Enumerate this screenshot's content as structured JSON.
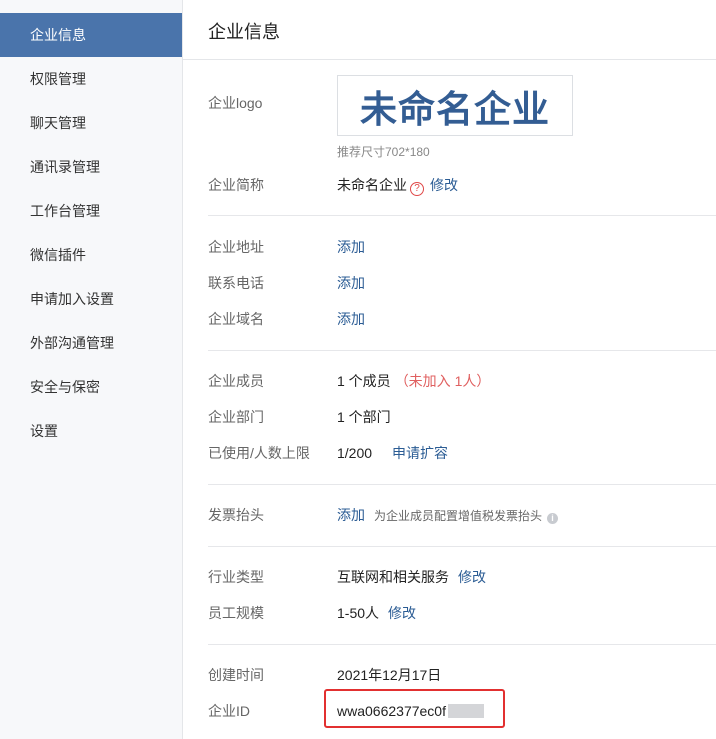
{
  "sidebar": {
    "items": [
      {
        "label": "企业信息"
      },
      {
        "label": "权限管理"
      },
      {
        "label": "聊天管理"
      },
      {
        "label": "通讯录管理"
      },
      {
        "label": "工作台管理"
      },
      {
        "label": "微信插件"
      },
      {
        "label": "申请加入设置"
      },
      {
        "label": "外部沟通管理"
      },
      {
        "label": "安全与保密"
      },
      {
        "label": "设置"
      }
    ],
    "active_index": 0
  },
  "main": {
    "title": "企业信息",
    "logo": {
      "label": "企业logo",
      "image_text": "未命名企业",
      "hint": "推荐尺寸702*180"
    },
    "short_name": {
      "label": "企业简称",
      "value": "未命名企业",
      "help_icon": "question-icon",
      "edit": "修改"
    },
    "address": {
      "label": "企业地址",
      "action": "添加"
    },
    "phone": {
      "label": "联系电话",
      "action": "添加"
    },
    "domain": {
      "label": "企业域名",
      "action": "添加"
    },
    "members": {
      "label": "企业成员",
      "value": "1 个成员",
      "note": "（未加入 1人）"
    },
    "departments": {
      "label": "企业部门",
      "value": "1 个部门"
    },
    "quota": {
      "label": "已使用/人数上限",
      "value": "1/200",
      "action": "申请扩容"
    },
    "invoice": {
      "label": "发票抬头",
      "action": "添加",
      "hint": "为企业成员配置增值税发票抬头",
      "info_icon": "info-icon"
    },
    "industry": {
      "label": "行业类型",
      "value": "互联网和相关服务",
      "edit": "修改"
    },
    "scale": {
      "label": "员工规模",
      "value": "1-50人",
      "edit": "修改"
    },
    "created": {
      "label": "创建时间",
      "value": "2021年12月17日"
    },
    "corp_id": {
      "label": "企业ID",
      "value": "wwa0662377ec0f"
    }
  }
}
